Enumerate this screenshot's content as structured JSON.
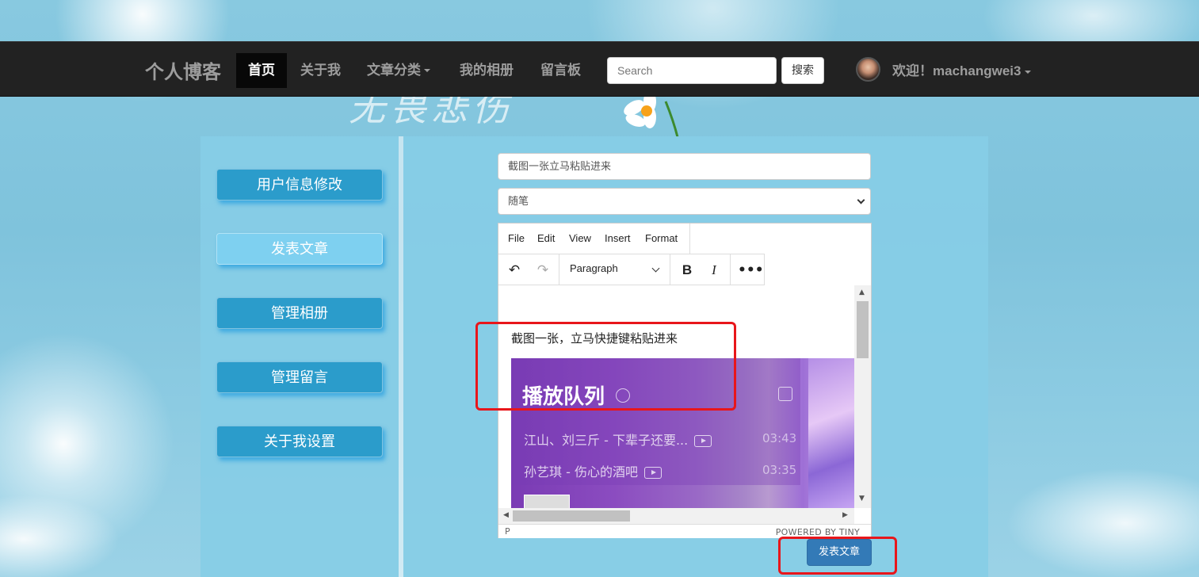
{
  "navbar": {
    "brand": "个人博客",
    "items": [
      {
        "label": "首页",
        "active": true
      },
      {
        "label": "关于我"
      },
      {
        "label": "文章分类",
        "dropdown": true
      },
      {
        "label": "我的相册"
      },
      {
        "label": "留言板"
      }
    ],
    "search": {
      "placeholder": "Search",
      "button": "搜索"
    },
    "user": {
      "welcome": "欢迎！machangwei3"
    }
  },
  "sidebar": {
    "items": [
      {
        "label": "用户信息修改"
      },
      {
        "label": "发表文章",
        "active": true
      },
      {
        "label": "管理相册"
      },
      {
        "label": "管理留言"
      },
      {
        "label": "关于我设置"
      }
    ]
  },
  "form": {
    "title_value": "截图一张立马粘贴进来",
    "category_value": "随笔",
    "publish_button": "发表文章"
  },
  "editor": {
    "menus": [
      "File",
      "Edit",
      "View",
      "Insert",
      "Format"
    ],
    "block_format": "Paragraph",
    "icons": [
      "undo-icon",
      "redo-icon",
      "bold-icon",
      "italic-icon",
      "more-icon"
    ],
    "content_text": "截图一张，立马快捷键粘贴进来",
    "status_path": "P",
    "powered_by": "POWERED BY TINY"
  },
  "pasted_image": {
    "title": "播放队列",
    "songs": [
      {
        "title": "江山、刘三斤 - 下辈子还要...",
        "time": "03:43"
      },
      {
        "title": "孙艺琪 - 伤心的酒吧",
        "time": "03:35"
      }
    ]
  },
  "background": {
    "decorative_text": "无畏悲伤"
  }
}
